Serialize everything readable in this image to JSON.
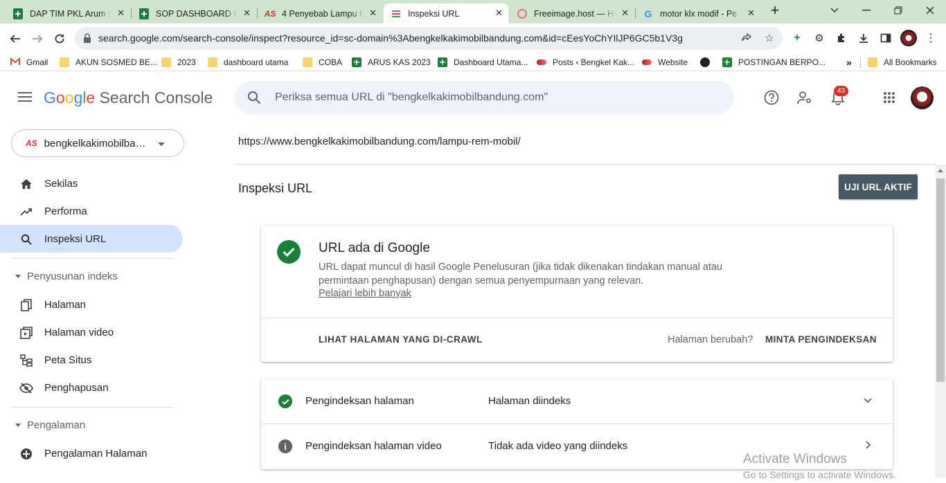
{
  "tabs": [
    {
      "title": "DAP TIM PKL Arum Sa",
      "icon": "google-sheets-icon"
    },
    {
      "title": "SOP DASHBOARD OP",
      "icon": "google-sheets-icon"
    },
    {
      "title": "4 Penyebab Lampu R",
      "icon": "as-logo-icon"
    },
    {
      "title": "Inspeksi URL",
      "icon": "search-console-icon"
    },
    {
      "title": "Freeimage.host — Ho",
      "icon": "freeimage-icon"
    },
    {
      "title": "motor klx modif - Pe",
      "icon": "google-icon"
    }
  ],
  "address_bar": {
    "url": "search.google.com/search-console/inspect?resource_id=sc-domain%3Abengkelkakimobilbandung.com&id=cEesYoChYIlJP6GC5b1V3g"
  },
  "bookmarks": [
    {
      "label": "Gmail",
      "icon": "gmail-icon"
    },
    {
      "label": "AKUN SOSMED BE...",
      "icon": "folder-icon"
    },
    {
      "label": "2023",
      "icon": "folder-icon"
    },
    {
      "label": "dashboard utama",
      "icon": "folder-icon"
    },
    {
      "label": "COBA",
      "icon": "folder-icon"
    },
    {
      "label": "ARUS KAS 2023",
      "icon": "google-sheets-icon"
    },
    {
      "label": "Dashboard Utama...",
      "icon": "google-sheets-icon"
    },
    {
      "label": "Posts ‹ Bengkel Kak...",
      "icon": "site-icon"
    },
    {
      "label": "Website",
      "icon": "site-icon"
    },
    {
      "label": "",
      "icon": "globe-icon"
    },
    {
      "label": "POSTINGAN BERPO...",
      "icon": "google-sheets-icon"
    }
  ],
  "bookmarks_more": "»",
  "all_bookmarks": "All Bookmarks",
  "app": {
    "logo_google": [
      "G",
      "o",
      "o",
      "g",
      "l",
      "e"
    ],
    "logo_product": "Search Console",
    "search_placeholder": "Periksa semua URL di \"bengkelkakimobilbandung.com\"",
    "notification_count": "43"
  },
  "sidebar": {
    "property": "bengkelkakimobilbandung.com",
    "property_icon_text": "AS",
    "items_top": [
      {
        "label": "Sekilas",
        "icon": "home-icon"
      },
      {
        "label": "Performa",
        "icon": "trending-up-icon"
      },
      {
        "label": "Inspeksi URL",
        "icon": "search-icon",
        "selected": true
      }
    ],
    "section_index": "Penyusunan indeks",
    "items_index": [
      {
        "label": "Halaman",
        "icon": "pages-icon"
      },
      {
        "label": "Halaman video",
        "icon": "video-page-icon"
      },
      {
        "label": "Peta Situs",
        "icon": "sitemap-icon"
      },
      {
        "label": "Penghapusan",
        "icon": "removal-icon"
      }
    ],
    "section_experience": "Pengalaman",
    "items_experience": [
      {
        "label": "Pengalaman Halaman",
        "icon": "page-experience-icon"
      }
    ]
  },
  "main": {
    "inspected_url": "https://www.bengkelkakimobilbandung.com/lampu-rem-mobil/",
    "page_title": "Inspeksi URL",
    "test_live_button": "UJI URL AKTIF",
    "status_card": {
      "title": "URL ada di Google",
      "description": "URL dapat muncul di hasil Google Penelusuran (jika tidak dikenakan tindakan manual atau permintaan penghapusan) dengan semua penyempurnaan yang relevan.",
      "learn_more": "Pelajari lebih banyak",
      "view_crawled": "LIHAT HALAMAN YANG DI-CRAWL",
      "page_changed": "Halaman berubah?",
      "request_indexing": "MINTA PENGINDEKSAN"
    },
    "details": [
      {
        "label": "Pengindeksan halaman",
        "value": "Halaman diindeks",
        "status": "ok",
        "chevron": "down"
      },
      {
        "label": "Pengindeksan halaman video",
        "value": "Tidak ada video yang diindeks",
        "status": "info",
        "chevron": "right"
      }
    ]
  },
  "watermark": {
    "line1": "Activate Windows",
    "line2": "Go to Settings to activate Windows."
  },
  "colors": {
    "tabbar": "#cfe5ce",
    "selected_nav": "#d3e3fd",
    "success": "#188038",
    "primary_button": "#455a64"
  }
}
